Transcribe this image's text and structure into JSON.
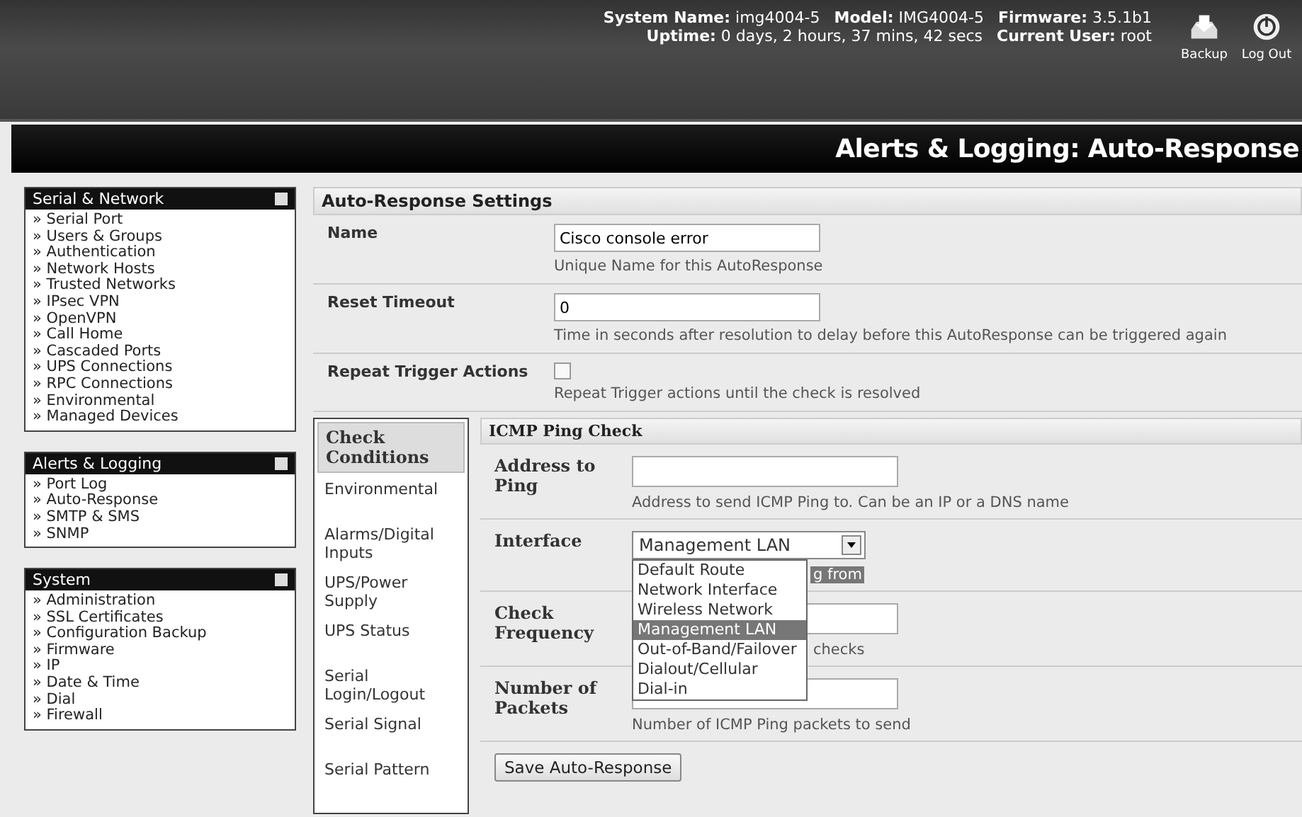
{
  "header": {
    "info": [
      {
        "label": "System Name:",
        "value": "img4004-5"
      },
      {
        "label": "Model:",
        "value": "IMG4004-5"
      },
      {
        "label": "Firmware:",
        "value": "3.5.1b1"
      },
      {
        "label": "Uptime:",
        "value": "0 days, 2 hours, 37 mins, 42 secs"
      },
      {
        "label": "Current User:",
        "value": "root"
      }
    ],
    "actions": [
      {
        "kind": "backup",
        "label": "Backup"
      },
      {
        "kind": "logout",
        "label": "Log Out"
      }
    ]
  },
  "page_title": "Alerts & Logging: Auto-Response",
  "sidebar": [
    {
      "title": "Serial & Network",
      "items": [
        "» Serial Port",
        "» Users & Groups",
        "» Authentication",
        "» Network Hosts",
        "» Trusted Networks",
        "» IPsec VPN",
        "» OpenVPN",
        "» Call Home",
        "» Cascaded Ports",
        "» UPS Connections",
        "» RPC Connections",
        "» Environmental",
        "» Managed Devices"
      ]
    },
    {
      "title": "Alerts & Logging",
      "items": [
        "» Port Log",
        "» Auto-Response",
        "» SMTP & SMS",
        "» SNMP"
      ]
    },
    {
      "title": "System",
      "items": [
        "» Administration",
        "» SSL Certificates",
        "» Configuration Backup",
        "» Firmware",
        "» IP",
        "» Date & Time",
        "» Dial",
        "» Firewall"
      ]
    }
  ],
  "settings": {
    "title": "Auto-Response Settings",
    "rows": [
      {
        "kind": "text",
        "label": "Name",
        "value": "Cisco console error",
        "hint": "Unique Name for this AutoResponse"
      },
      {
        "kind": "text",
        "label": "Reset Timeout",
        "value": "0",
        "hint": "Time in seconds after resolution to delay before this AutoResponse can be triggered again"
      },
      {
        "kind": "checkbox",
        "label": "Repeat Trigger Actions",
        "checked": false,
        "hint": "Repeat Trigger actions until the check is resolved"
      }
    ]
  },
  "check_tabs": [
    {
      "label": "Check Conditions",
      "selected": true
    },
    {
      "label": "Environmental",
      "selected": false
    },
    {
      "label": "Alarms/Digital Inputs",
      "selected": false
    },
    {
      "label": "UPS/Power Supply",
      "selected": false
    },
    {
      "label": "UPS Status",
      "selected": false
    },
    {
      "label": "Serial Login/Logout",
      "selected": false
    },
    {
      "label": "Serial Signal",
      "selected": false
    },
    {
      "label": "Serial Pattern",
      "selected": false
    }
  ],
  "check": {
    "title": "ICMP Ping Check",
    "rows": [
      {
        "kind": "text",
        "label": "Address to Ping",
        "value": "",
        "hint": "Address to send ICMP Ping to. Can be an IP or a DNS name"
      },
      {
        "kind": "select",
        "label": "Interface",
        "value": "Management LAN",
        "hint": "g from",
        "options": [
          {
            "label": "Default Route",
            "selected": false
          },
          {
            "label": "Network Interface",
            "selected": false
          },
          {
            "label": "Wireless Network",
            "selected": false
          },
          {
            "label": "Management LAN",
            "selected": true
          },
          {
            "label": "Out-of-Band/Failover",
            "selected": false
          },
          {
            "label": "Dialout/Cellular",
            "selected": false
          },
          {
            "label": "Dial-in",
            "selected": false
          }
        ]
      },
      {
        "kind": "text",
        "label": "Check Frequency",
        "value": "",
        "hint": "checks"
      },
      {
        "kind": "text",
        "label": "Number of Packets",
        "value": "",
        "hint": "Number of ICMP Ping packets to send"
      }
    ],
    "save": "Save Auto-Response"
  }
}
